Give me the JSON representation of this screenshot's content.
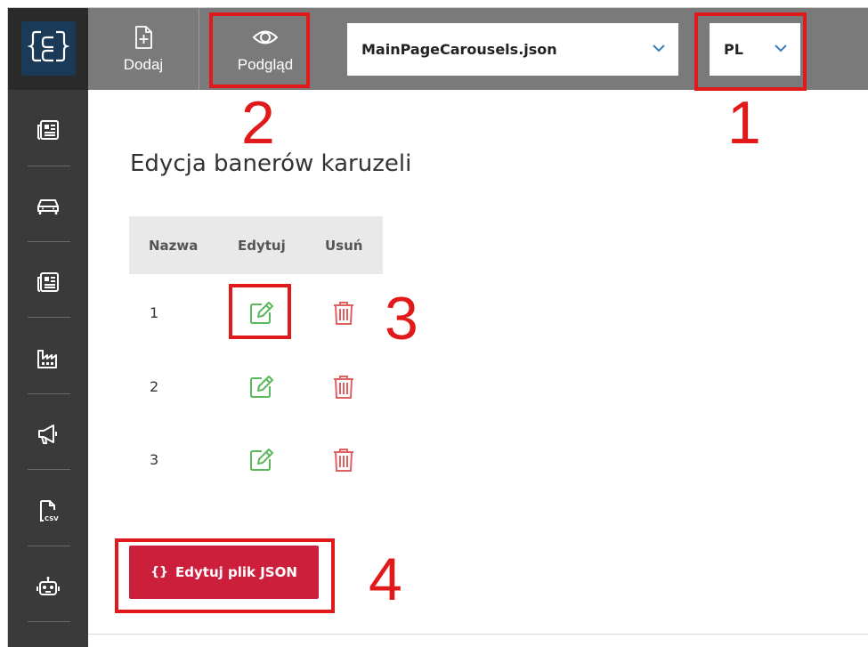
{
  "sidebar": {
    "logo": "cc-logo",
    "items": [
      {
        "icon": "news-icon"
      },
      {
        "icon": "car-icon"
      },
      {
        "icon": "news-icon"
      },
      {
        "icon": "factory-icon"
      },
      {
        "icon": "megaphone-icon"
      },
      {
        "icon": "csv-file-icon"
      },
      {
        "icon": "robot-icon"
      }
    ]
  },
  "toolbar": {
    "add_label": "Dodaj",
    "preview_label": "Podgląd",
    "file_select_value": "MainPageCarousels.json",
    "lang_select_value": "PL"
  },
  "annotations": [
    "1",
    "2",
    "3",
    "4"
  ],
  "main": {
    "title": "Edycja banerów karuzeli",
    "table": {
      "headers": [
        "Nazwa",
        "Edytuj",
        "Usuń"
      ],
      "rows": [
        {
          "name": "1"
        },
        {
          "name": "2"
        },
        {
          "name": "3"
        }
      ]
    },
    "json_button_icon": "{}",
    "json_button_label": "Edytuj plik JSON"
  },
  "colors": {
    "accent_red": "#cc1f3c",
    "edit_green": "#5cb85c",
    "delete_red": "#e06060",
    "annotation_red": "#e01a1a"
  }
}
